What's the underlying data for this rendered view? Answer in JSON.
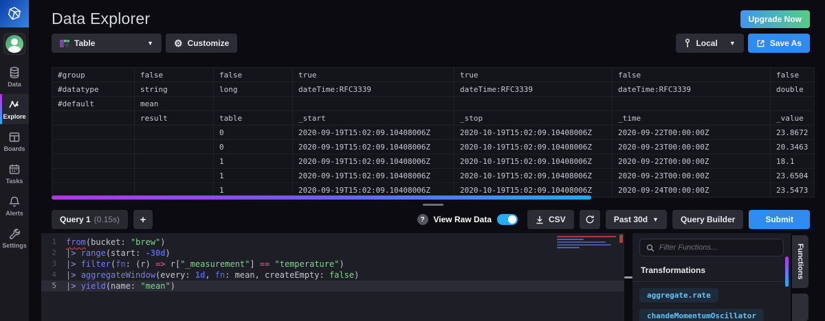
{
  "app": {
    "title": "Data Explorer",
    "upgrade_label": "Upgrade Now"
  },
  "sidebar": {
    "items": [
      {
        "label": "Data",
        "icon": "database-icon",
        "active": false
      },
      {
        "label": "Explore",
        "icon": "explore-graph-icon",
        "active": true
      },
      {
        "label": "Boards",
        "icon": "dashboards-icon",
        "active": false
      },
      {
        "label": "Tasks",
        "icon": "calendar-icon",
        "active": false
      },
      {
        "label": "Alerts",
        "icon": "bell-icon",
        "active": false
      },
      {
        "label": "Settings",
        "icon": "wrench-icon",
        "active": false
      }
    ]
  },
  "toolbar": {
    "view_type_label": "Table",
    "customize_label": "Customize",
    "timezone_label": "Local",
    "save_as_label": "Save As"
  },
  "table": {
    "rows": [
      [
        "#group",
        "false",
        "false",
        "true",
        "true",
        "false",
        "false"
      ],
      [
        "#datatype",
        "string",
        "long",
        "dateTime:RFC3339",
        "dateTime:RFC3339",
        "dateTime:RFC3339",
        "double"
      ],
      [
        "#default",
        "mean",
        "",
        "",
        "",
        "",
        ""
      ],
      [
        "",
        "result",
        "table",
        "_start",
        "_stop",
        "_time",
        "_value"
      ],
      [
        "",
        "",
        "0",
        "2020-09-19T15:02:09.10408006Z",
        "2020-10-19T15:02:09.10408006Z",
        "2020-09-22T00:00:00Z",
        "23.8672"
      ],
      [
        "",
        "",
        "0",
        "2020-09-19T15:02:09.10408006Z",
        "2020-10-19T15:02:09.10408006Z",
        "2020-09-23T00:00:00Z",
        "20.3463"
      ],
      [
        "",
        "",
        "1",
        "2020-09-19T15:02:09.10408006Z",
        "2020-10-19T15:02:09.10408006Z",
        "2020-09-22T00:00:00Z",
        "18.1"
      ],
      [
        "",
        "",
        "1",
        "2020-09-19T15:02:09.10408006Z",
        "2020-10-19T15:02:09.10408006Z",
        "2020-09-23T00:00:00Z",
        "23.6504"
      ],
      [
        "",
        "",
        "1",
        "2020-09-19T15:02:09.10408006Z",
        "2020-10-19T15:02:09.10408006Z",
        "2020-09-24T00:00:00Z",
        "23.5473"
      ]
    ]
  },
  "query_panel": {
    "tab_label": "Query 1",
    "tab_duration": "(0.15s)",
    "add_query_label": "+",
    "help_label": "?",
    "view_raw_data_label": "View Raw Data",
    "view_raw_data_on": true,
    "csv_label": "CSV",
    "time_range_label": "Past 30d",
    "query_builder_label": "Query Builder",
    "submit_label": "Submit"
  },
  "editor": {
    "lines": [
      {
        "num": "1",
        "active": false,
        "tokens": [
          [
            "fn-err",
            "from"
          ],
          [
            "plain",
            "(bucket: "
          ],
          [
            "str",
            "\"brew\""
          ],
          [
            "plain",
            ")"
          ]
        ]
      },
      {
        "num": "2",
        "active": false,
        "tokens": [
          [
            "plain",
            "  "
          ],
          [
            "pipe",
            "|> "
          ],
          [
            "fn",
            "range"
          ],
          [
            "plain",
            "(start: "
          ],
          [
            "num",
            "-30d"
          ],
          [
            "plain",
            ")"
          ]
        ]
      },
      {
        "num": "3",
        "active": false,
        "tokens": [
          [
            "plain",
            "  "
          ],
          [
            "pipe",
            "|> "
          ],
          [
            "fn",
            "filter"
          ],
          [
            "plain",
            "("
          ],
          [
            "kw",
            "fn"
          ],
          [
            "plain",
            ": (r) "
          ],
          [
            "op",
            "=>"
          ],
          [
            "plain",
            " r["
          ],
          [
            "str",
            "\"_measurement\""
          ],
          [
            "plain",
            "] "
          ],
          [
            "op",
            "=="
          ],
          [
            "plain",
            " "
          ],
          [
            "str",
            "\"temperature\""
          ],
          [
            "plain",
            ")"
          ]
        ]
      },
      {
        "num": "4",
        "active": false,
        "tokens": [
          [
            "plain",
            "  "
          ],
          [
            "pipe",
            "|> "
          ],
          [
            "fn",
            "aggregateWindow"
          ],
          [
            "plain",
            "(every: "
          ],
          [
            "num",
            "1d"
          ],
          [
            "plain",
            ", "
          ],
          [
            "kw",
            "fn"
          ],
          [
            "plain",
            ": mean, createEmpty: "
          ],
          [
            "bool",
            "false"
          ],
          [
            "plain",
            ")"
          ]
        ]
      },
      {
        "num": "5",
        "active": true,
        "tokens": [
          [
            "plain",
            "  "
          ],
          [
            "pipe",
            "|> "
          ],
          [
            "fn",
            "yield"
          ],
          [
            "plain",
            "(name: "
          ],
          [
            "str",
            "\"mean\""
          ],
          [
            "plain",
            ")"
          ]
        ]
      }
    ]
  },
  "functions_panel": {
    "filter_placeholder": "Filter Functions...",
    "category": "Transformations",
    "items": [
      "aggregate.rate",
      "chandeMomentumOscillator"
    ],
    "tab_label": "Functions"
  },
  "colors": {
    "accent_blue": "#22adf6",
    "button_blue": "#2e8cf0",
    "gradient_purple": "#bf2fe3",
    "upgrade_gradient_start": "#3f97ef",
    "upgrade_gradient_end": "#55ce83",
    "error_red": "#c0392b",
    "string_green": "#7bd88b",
    "function_purple": "#767df2",
    "operator_pink": "#ff5e8c"
  }
}
